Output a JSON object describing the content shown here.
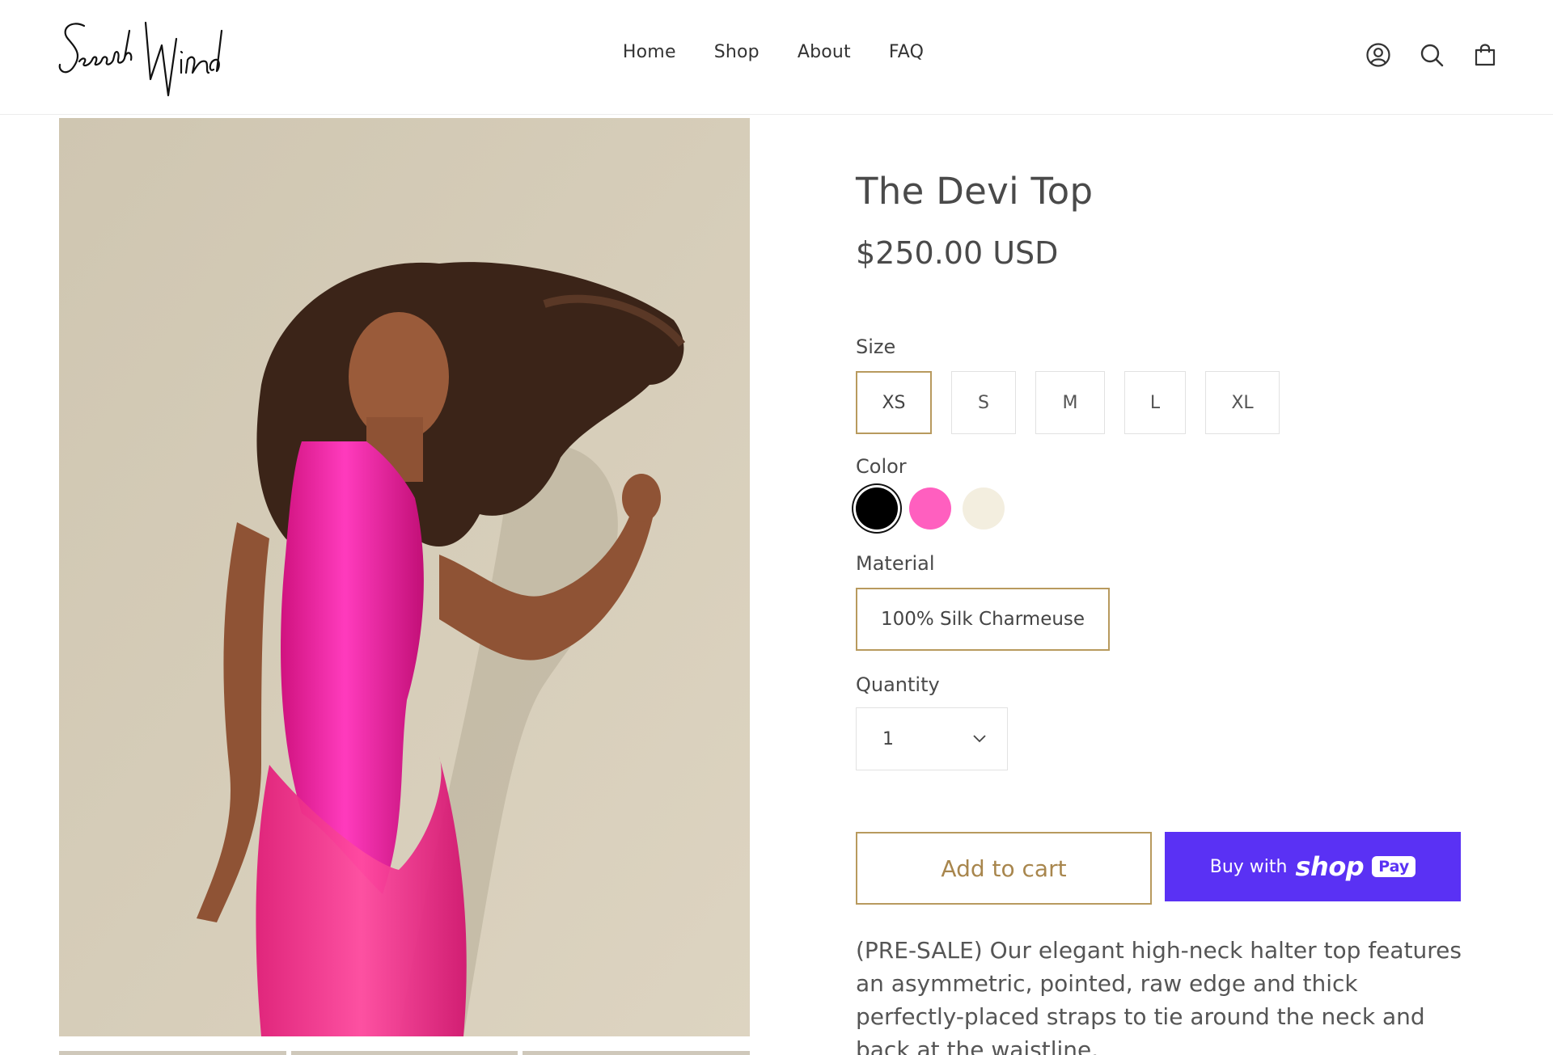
{
  "header": {
    "logo_text": "Second Wind",
    "nav": [
      {
        "label": "Home"
      },
      {
        "label": "Shop"
      },
      {
        "label": "About"
      },
      {
        "label": "FAQ"
      }
    ],
    "icons": [
      "account-icon",
      "search-icon",
      "cart-icon"
    ]
  },
  "product": {
    "title": "The Devi Top",
    "price": "$250.00 USD",
    "size_label": "Size",
    "sizes": [
      "XS",
      "S",
      "M",
      "L",
      "XL"
    ],
    "selected_size": "XS",
    "color_label": "Color",
    "colors": [
      "#000000",
      "#ff5fbf",
      "#f3eedf"
    ],
    "selected_color": "#000000",
    "material_label": "Material",
    "material": "100% Silk Charmeuse",
    "quantity_label": "Quantity",
    "quantity": "1",
    "add_to_cart": "Add to cart",
    "buy_with": "Buy with",
    "shop_word": "shop",
    "pay_word": "Pay",
    "description": "(PRE-SALE) Our elegant high-neck halter top features an asymmetric, pointed, raw edge and thick perfectly-placed straps to tie around the neck and back at the waistline."
  },
  "colors": {
    "accent_gold": "#b89a5e",
    "shop_pay_purple": "#5a31f4",
    "garment_pink": "#f01fa0"
  }
}
